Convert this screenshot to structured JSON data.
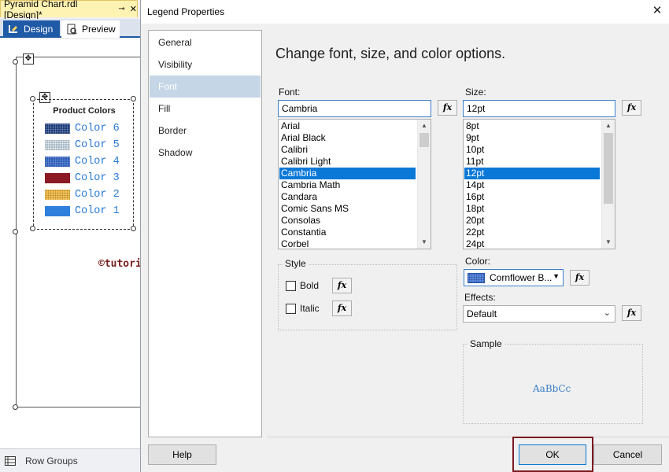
{
  "designer": {
    "document_tab": "Pyramid Chart.rdl [Design]*",
    "pin_icon": "pin-icon",
    "close_glyph": "✕",
    "view_tabs": [
      {
        "label": "Design",
        "icon": "design-icon",
        "active": true
      },
      {
        "label": "Preview",
        "icon": "preview-icon",
        "active": false
      }
    ],
    "legend": {
      "title": "Product Colors",
      "items": [
        {
          "label": "Color 6",
          "color": "#1f3a6b"
        },
        {
          "label": "Color 5",
          "color": "#a9bac6"
        },
        {
          "label": "Color 4",
          "color": "#2f5bb2"
        },
        {
          "label": "Color 3",
          "color": "#8b1a24"
        },
        {
          "label": "Color 2",
          "color": "#f2c25b"
        },
        {
          "label": "Color 1",
          "color": "#2f80dc"
        }
      ]
    },
    "watermark": "©tutorialgateway.org",
    "row_groups": "Row Groups"
  },
  "dialog": {
    "title": "Legend Properties",
    "close_glyph": "✕",
    "nav": [
      "General",
      "Visibility",
      "Font",
      "Fill",
      "Border",
      "Shadow"
    ],
    "nav_selected": "Font",
    "heading": "Change font, size, and color options.",
    "font": {
      "label": "Font:",
      "value": "Cambria",
      "options": [
        "Arial",
        "Arial Black",
        "Calibri",
        "Calibri Light",
        "Cambria",
        "Cambria Math",
        "Candara",
        "Comic Sans MS",
        "Consolas",
        "Constantia",
        "Corbel"
      ],
      "selected": "Cambria"
    },
    "size": {
      "label": "Size:",
      "value": "12pt",
      "options": [
        "8pt",
        "9pt",
        "10pt",
        "11pt",
        "12pt",
        "14pt",
        "16pt",
        "18pt",
        "20pt",
        "22pt",
        "24pt"
      ],
      "selected": "12pt"
    },
    "fx_label": "fx",
    "style": {
      "title": "Style",
      "bold_label": "Bold",
      "bold_checked": false,
      "italic_label": "Italic",
      "italic_checked": false
    },
    "color": {
      "label": "Color:",
      "value": "Cornflower B...",
      "swatch": "#6495ed"
    },
    "effects": {
      "label": "Effects:",
      "value": "Default"
    },
    "sample": {
      "title": "Sample",
      "text": "AaBbCc"
    },
    "buttons": {
      "help": "Help",
      "ok": "OK",
      "cancel": "Cancel"
    },
    "accent_color": "#0a78d7",
    "highlight_color": "#7b1a22"
  }
}
